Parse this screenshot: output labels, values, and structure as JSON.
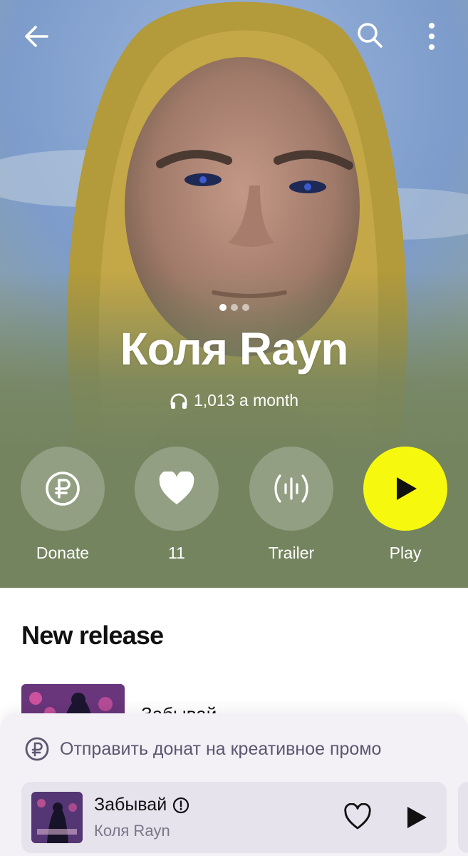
{
  "artist": {
    "name": "Коля Rayn",
    "monthly_listeners": "1,013 a month"
  },
  "icons": {
    "back": "arrow-left-icon",
    "search": "search-icon",
    "more": "vertical-dots-icon",
    "headphones": "headphones-icon",
    "donate": "ruble-coin-icon",
    "like": "heart-icon",
    "trailer": "waveform-icon",
    "play": "play-icon",
    "explicit": "explicit-icon"
  },
  "actions": {
    "donate_label": "Donate",
    "likes_label": "11",
    "trailer_label": "Trailer",
    "play_label": "Play"
  },
  "section": {
    "title": "New release"
  },
  "release": {
    "title": "Забывай"
  },
  "promo": {
    "text": "Отправить донат на креативное промо"
  },
  "now_playing": {
    "title": "Забывай",
    "artist": "Коля Rayn"
  },
  "colors": {
    "play_accent": "#f6f90e",
    "hero_bottom": "#74845f",
    "sheet_bg": "#f3f1f6"
  }
}
